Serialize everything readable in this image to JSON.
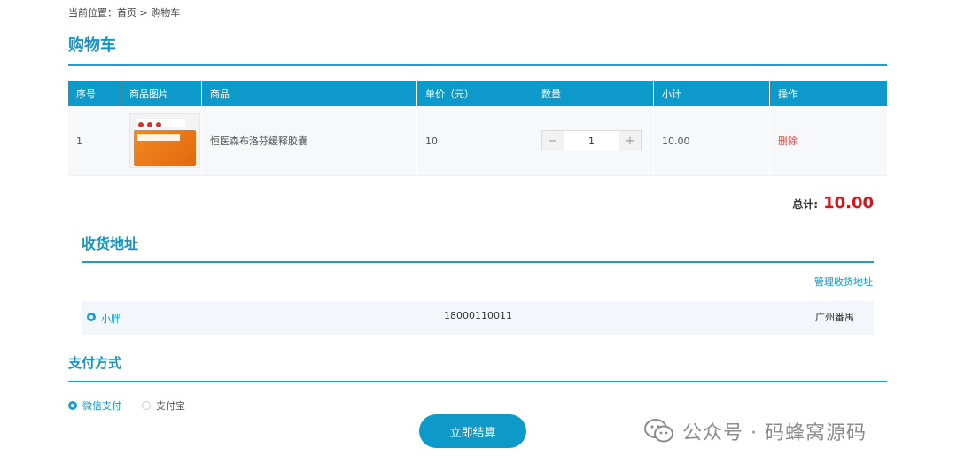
{
  "breadcrumb": "当前位置：首页 > 购物车",
  "cart": {
    "title": "购物车",
    "columns": [
      "序号",
      "商品图片",
      "商品",
      "单价（元）",
      "数量",
      "小计",
      "操作"
    ],
    "rows": [
      {
        "index": "1",
        "product_name": "恒医森布洛芬缓释胶囊",
        "unit_price": "10",
        "quantity_minus": "−",
        "quantity": "1",
        "quantity_plus": "+",
        "subtotal": "10.00",
        "action": "删除"
      }
    ],
    "total_label": "总计:",
    "total_value": "10.00"
  },
  "address": {
    "title": "收货地址",
    "manage_label": "管理收货地址",
    "entries": [
      {
        "name": "小胖",
        "phone": "18000110011",
        "city": "广州番禺",
        "selected": true
      }
    ]
  },
  "payment": {
    "title": "支付方式",
    "options": [
      {
        "label": "微信支付",
        "selected": true
      },
      {
        "label": "支付宝",
        "selected": false
      }
    ]
  },
  "checkout_label": "立即结算",
  "watermark": "公众号 · 码蜂窝源码",
  "colors": {
    "accent": "#0d99c9",
    "title": "#1593c4",
    "price_total": "#d6161c",
    "delete": "#e84141"
  },
  "icons": {
    "watermark_icon": "wechat-icon",
    "radio_on": "radio-checked-icon",
    "radio_off": "radio-unchecked-icon"
  }
}
